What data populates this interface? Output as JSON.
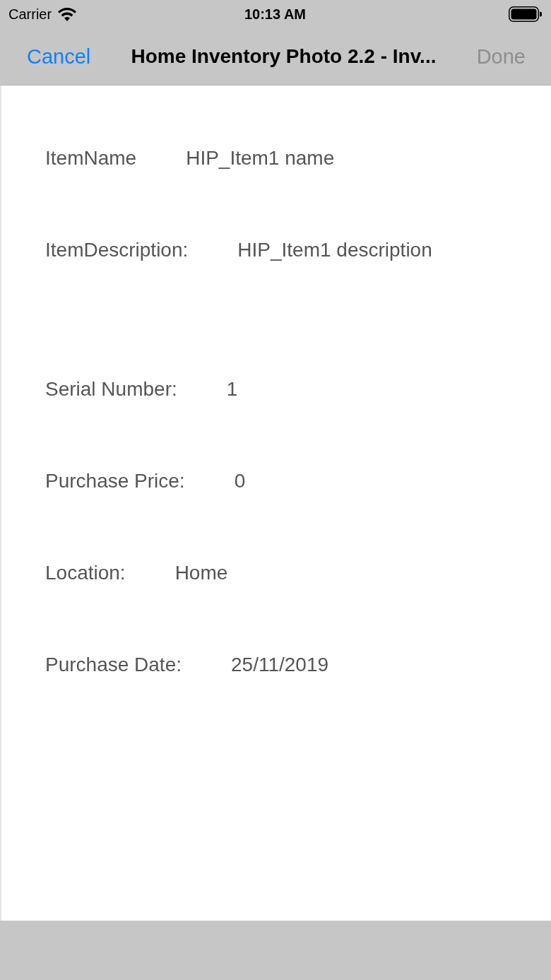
{
  "status_bar": {
    "carrier": "Carrier",
    "time": "10:13 AM"
  },
  "nav_bar": {
    "cancel": {
      "label": "Cancel",
      "disabled": false
    },
    "title": "Home Inventory Photo 2.2 - Inv...",
    "done": {
      "label": "Done",
      "disabled": true
    }
  },
  "fields": [
    {
      "kind": "text",
      "label": "ItemName",
      "value": "HIP_Item1 name"
    },
    {
      "kind": "multiline",
      "label": "ItemDescription:",
      "value": "HIP_Item1 description"
    },
    {
      "kind": "text",
      "label": "Serial Number:",
      "value": "1"
    },
    {
      "kind": "text",
      "label": "Purchase Price:",
      "value": "0"
    },
    {
      "kind": "text",
      "label": "Location:",
      "value": "Home"
    },
    {
      "kind": "text",
      "label": "Purchase Date:",
      "value": "25/11/2019"
    }
  ]
}
